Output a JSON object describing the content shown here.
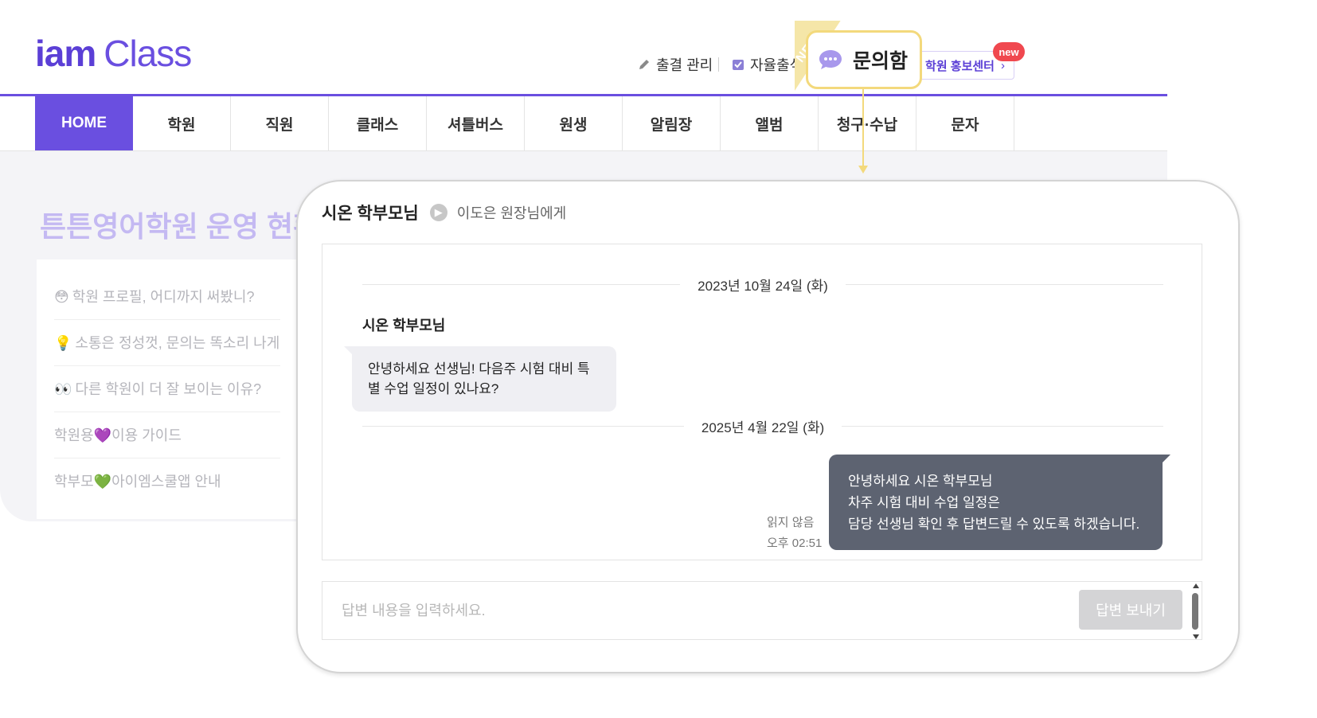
{
  "app": {
    "logo_part1": "iam",
    "logo_part2": "Class"
  },
  "header": {
    "util_attendance": "출결 관리",
    "util_self_check": "자율출석",
    "promo_button": "학원 홍보센터",
    "promo_badge": "new"
  },
  "nav": {
    "items": [
      "HOME",
      "학원",
      "직원",
      "클래스",
      "셔틀버스",
      "원생",
      "알림장",
      "앨범",
      "청구·수납",
      "문자"
    ],
    "active_index": 0
  },
  "dashboard": {
    "title": "튼튼영어학원 운영 현황",
    "side_items": [
      {
        "emoji": "😳",
        "text": "학원 프로필, 어디까지 써봤니?"
      },
      {
        "emoji": "💡",
        "text": "소통은 정성껏, 문의는 똑소리 나게"
      },
      {
        "emoji": "👀",
        "text": "다른 학원이 더 잘 보이는 이유?"
      },
      {
        "emoji": "",
        "text": "학원용💜이용 가이드"
      },
      {
        "emoji": "",
        "text": "학부모💚아이엠스쿨앱 안내"
      }
    ]
  },
  "callout": {
    "ribbon": "NEW",
    "label": "문의함",
    "color": "#f3d97c"
  },
  "popup": {
    "sender": "시온 학부모님",
    "recipient": "이도은 원장님에게",
    "date1": "2023년 10월 24일 (화)",
    "incoming_name": "시온 학부모님",
    "incoming_line1": "안녕하세요 선생님! 다음주 시험 대비 특",
    "incoming_line2": "별 수업 일정이 있나요?",
    "date2": "2025년 4월 22일 (화)",
    "outgoing_line1": "안녕하세요 시온 학부모님",
    "outgoing_line2": "차주 시험 대비 수업 일정은",
    "outgoing_line3": "담당 선생님 확인 후 답변드릴 수 있도록 하겠습니다.",
    "read_status": "읽지 않음",
    "sent_time": "오후 02:51",
    "reply_placeholder": "답변 내용을 입력하세요.",
    "send_button": "답변 보내기"
  },
  "colors": {
    "brand": "#6a4fe0",
    "outgoing_bubble": "#5d6371",
    "incoming_bubble": "#efeff3",
    "badge": "#f0484f"
  }
}
